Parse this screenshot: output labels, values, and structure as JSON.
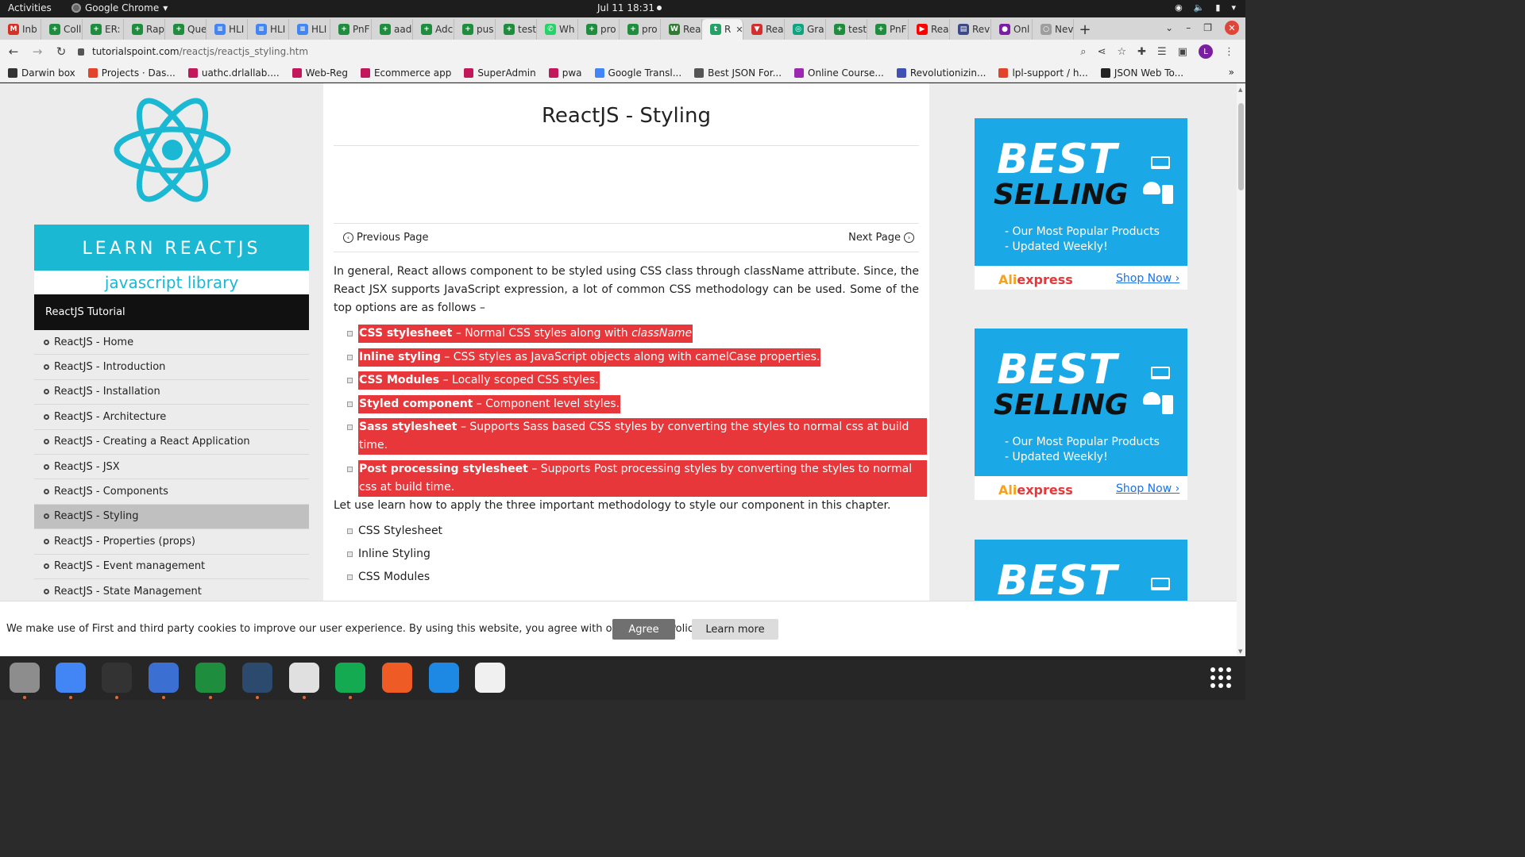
{
  "system": {
    "activities": "Activities",
    "app_name": "Google Chrome",
    "clock": "Jul 11  18:31"
  },
  "tabs": [
    {
      "label": "Inb",
      "color": "#d93025",
      "glyph": "M"
    },
    {
      "label": "Coll",
      "color": "#1e8e3e",
      "glyph": "+"
    },
    {
      "label": "ER:",
      "color": "#1e8e3e",
      "glyph": "+"
    },
    {
      "label": "Rap",
      "color": "#1e8e3e",
      "glyph": "+"
    },
    {
      "label": "Que",
      "color": "#1e8e3e",
      "glyph": "+"
    },
    {
      "label": "HLI",
      "color": "#4285f4",
      "glyph": "≡"
    },
    {
      "label": "HLI",
      "color": "#4285f4",
      "glyph": "≡"
    },
    {
      "label": "HLI",
      "color": "#4285f4",
      "glyph": "≡"
    },
    {
      "label": "PnF",
      "color": "#1e8e3e",
      "glyph": "+"
    },
    {
      "label": "aad",
      "color": "#1e8e3e",
      "glyph": "+"
    },
    {
      "label": "Adc",
      "color": "#1e8e3e",
      "glyph": "+"
    },
    {
      "label": "pus",
      "color": "#1e8e3e",
      "glyph": "+"
    },
    {
      "label": "test",
      "color": "#1e8e3e",
      "glyph": "+"
    },
    {
      "label": "Wh",
      "color": "#25d366",
      "glyph": "✆"
    },
    {
      "label": "pro",
      "color": "#1e8e3e",
      "glyph": "+"
    },
    {
      "label": "pro",
      "color": "#1e8e3e",
      "glyph": "+"
    },
    {
      "label": "Rea",
      "color": "#2e7d32",
      "glyph": "W"
    },
    {
      "label": "R",
      "color": "#21a366",
      "glyph": "t",
      "active": true
    },
    {
      "label": "Rea",
      "color": "#d32f2f",
      "glyph": "▼"
    },
    {
      "label": "Gra",
      "color": "#10a37f",
      "glyph": "◎"
    },
    {
      "label": "test",
      "color": "#1e8e3e",
      "glyph": "+"
    },
    {
      "label": "PnF",
      "color": "#1e8e3e",
      "glyph": "+"
    },
    {
      "label": "Rea",
      "color": "#ff0000",
      "glyph": "▶"
    },
    {
      "label": "Rev",
      "color": "#3c4a8a",
      "glyph": "▤"
    },
    {
      "label": "Onl",
      "color": "#7b1fa2",
      "glyph": "●"
    },
    {
      "label": "Nev",
      "color": "#9e9e9e",
      "glyph": "○"
    }
  ],
  "address": {
    "domain": "tutorialspoint.com",
    "path": "/reactjs/reactjs_styling.htm"
  },
  "profile_initial": "L",
  "bookmarks": [
    {
      "label": "Darwin box",
      "color": "#333"
    },
    {
      "label": "Projects · Das...",
      "color": "#e24329"
    },
    {
      "label": "uathc.drlallab....",
      "color": "#c2185b"
    },
    {
      "label": "Web-Reg",
      "color": "#c2185b"
    },
    {
      "label": "Ecommerce app",
      "color": "#c2185b"
    },
    {
      "label": "SuperAdmin",
      "color": "#c2185b"
    },
    {
      "label": "pwa",
      "color": "#c2185b"
    },
    {
      "label": "Google Transl...",
      "color": "#4285f4"
    },
    {
      "label": "Best JSON For...",
      "color": "#555"
    },
    {
      "label": "Online Course...",
      "color": "#9c27b0"
    },
    {
      "label": "Revolutionizin...",
      "color": "#3f51b5"
    },
    {
      "label": "lpl-support / h...",
      "color": "#e24329"
    },
    {
      "label": "JSON Web To...",
      "color": "#222"
    }
  ],
  "sidebar": {
    "banner_title": "LEARN REACTJS",
    "banner_subtitle": "javascript library",
    "heading": "ReactJS Tutorial",
    "items": [
      "ReactJS - Home",
      "ReactJS - Introduction",
      "ReactJS - Installation",
      "ReactJS - Architecture",
      "ReactJS - Creating a React Application",
      "ReactJS - JSX",
      "ReactJS - Components",
      "ReactJS - Styling",
      "ReactJS - Properties (props)",
      "ReactJS - Event management",
      "ReactJS - State Management"
    ],
    "selected_index": 7
  },
  "main": {
    "title": "ReactJS - Styling",
    "prev_label": "Previous Page",
    "next_label": "Next Page",
    "intro": "In general, React allows component to be styled using CSS class through className attribute. Since, the React JSX supports JavaScript expression, a lot of common CSS methodology can be used. Some of the top options are as follows –",
    "options": [
      {
        "term": "CSS stylesheet",
        "desc": " – Normal CSS styles along with ",
        "em": "className"
      },
      {
        "term": "Inline styling",
        "desc": " – CSS styles as JavaScript objects along with camelCase properties."
      },
      {
        "term": "CSS Modules",
        "desc": " – Locally scoped CSS styles."
      },
      {
        "term": "Styled component",
        "desc": " – Component level styles."
      },
      {
        "term": "Sass stylesheet",
        "desc": " – Supports Sass based CSS styles by converting the styles to normal css at build time."
      },
      {
        "term": "Post processing stylesheet",
        "desc": " – Supports Post processing styles by converting the styles to normal css at build time."
      }
    ],
    "para2": "Let use learn how to apply the three important methodology to style our component in this chapter.",
    "methods": [
      "CSS Stylesheet",
      "Inline Styling",
      "CSS Modules"
    ],
    "highlight_color": "#e8373a"
  },
  "ad": {
    "best": "BEST",
    "selling": "SELLING",
    "line1": "- Our Most Popular Products",
    "line2": "- Updated Weekly!",
    "brand_a": "Ali",
    "brand_b": "express",
    "cta": "Shop Now ›",
    "bg_color": "#1aa9e6"
  },
  "cookie": {
    "message": "We make use of First and third party cookies to improve our user experience. By using this website, you agree with our Cookies Policy.",
    "agree": "Agree",
    "learn_more": "Learn more"
  },
  "dock": [
    {
      "name": "files-icon",
      "color": "#8d8d8d"
    },
    {
      "name": "chrome-icon",
      "color": "#4285f4"
    },
    {
      "name": "terminal-icon",
      "color": "#333333"
    },
    {
      "name": "text-editor-icon",
      "color": "#3b6fd1"
    },
    {
      "name": "chat-icon",
      "color": "#1e8e3e"
    },
    {
      "name": "dbeaver-icon",
      "color": "#2c4a6e"
    },
    {
      "name": "document-viewer-icon",
      "color": "#e0e0e0"
    },
    {
      "name": "mongodb-compass-icon",
      "color": "#13aa52"
    },
    {
      "name": "postman-icon",
      "color": "#ef5b25"
    },
    {
      "name": "vscode-icon",
      "color": "#1e88e5"
    },
    {
      "name": "gimp-icon",
      "color": "#f0f0f0"
    }
  ]
}
